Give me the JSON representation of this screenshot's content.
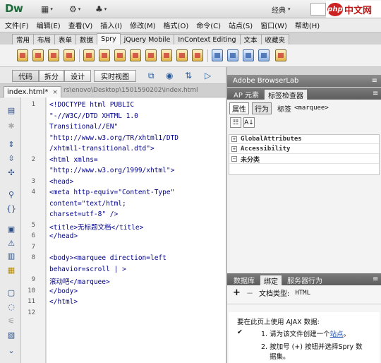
{
  "app": {
    "logo": "Dw",
    "layout_label": "经典",
    "watermark_text": "中文网",
    "watermark_badge": "php"
  },
  "menu": [
    "文件(F)",
    "编辑(E)",
    "查看(V)",
    "插入(I)",
    "修改(M)",
    "格式(O)",
    "命令(C)",
    "站点(S)",
    "窗口(W)",
    "帮助(H)"
  ],
  "insert_tabs": [
    {
      "label": "常用",
      "active": false
    },
    {
      "label": "布局",
      "active": false
    },
    {
      "label": "表单",
      "active": false
    },
    {
      "label": "数据",
      "active": false
    },
    {
      "label": "Spry",
      "active": true
    },
    {
      "label": "jQuery Mobile",
      "active": false
    },
    {
      "label": "InContext Editing",
      "active": false
    },
    {
      "label": "文本",
      "active": false
    },
    {
      "label": "收藏夹",
      "active": false
    }
  ],
  "view_buttons": [
    "代码",
    "拆分",
    "设计",
    "实时视图"
  ],
  "doc_tab": {
    "label": "index.html*",
    "close": "×",
    "path": "rs\\enovo\\Desktop\\1501590202\\index.html"
  },
  "code_lines": [
    {
      "num": "1",
      "text": "<!DOCTYPE html PUBLIC"
    },
    {
      "num": "",
      "text": "\"-//W3C//DTD XHTML 1.0"
    },
    {
      "num": "",
      "text": "Transitional//EN\""
    },
    {
      "num": "",
      "text": "\"http://www.w3.org/TR/xhtml1/DTD"
    },
    {
      "num": "",
      "text": "/xhtml1-transitional.dtd\">"
    },
    {
      "num": "2",
      "text": "<html xmlns="
    },
    {
      "num": "",
      "text": "\"http://www.w3.org/1999/xhtml\">"
    },
    {
      "num": "3",
      "text": "<head>"
    },
    {
      "num": "4",
      "text": "<meta http-equiv=\"Content-Type\""
    },
    {
      "num": "",
      "text": "content=\"text/html;"
    },
    {
      "num": "",
      "text": "charset=utf-8\" />"
    },
    {
      "num": "5",
      "text": "<title>无标题文档</title>"
    },
    {
      "num": "6",
      "text": "</head>"
    },
    {
      "num": "7",
      "text": ""
    },
    {
      "num": "8",
      "text": "<body><marquee direction=left"
    },
    {
      "num": "",
      "text": "behavior=scroll | >"
    },
    {
      "num": "9",
      "text": "滚动吧</marquee>"
    },
    {
      "num": "10",
      "text": "</body>"
    },
    {
      "num": "11",
      "text": "</html>"
    },
    {
      "num": "12",
      "text": ""
    }
  ],
  "browserlab": {
    "title": "Adobe BrowserLab",
    "menu": "≡"
  },
  "ap_tabs": [
    {
      "label": "AP 元素",
      "active": false
    },
    {
      "label": "标签检查器",
      "active": true
    }
  ],
  "tag_inspector": {
    "attr_btn": "属性",
    "behavior_btn": "行为",
    "tag_label": "标签",
    "tag_value": "<marquee>",
    "categories": [
      "GlobalAttributes",
      "Accessibility",
      "未分类"
    ]
  },
  "bottom_tabs": [
    {
      "label": "数据库",
      "active": false
    },
    {
      "label": "绑定",
      "active": true
    },
    {
      "label": "服务器行为",
      "active": false
    }
  ],
  "bindings": {
    "add": "+",
    "remove": "−",
    "doc_type_label": "文档类型:",
    "doc_type_value": "HTML",
    "intro": "要在此页上使用 AJAX 数据:",
    "check": "✔",
    "step1_prefix": "1. 请为该文件创建一个",
    "step1_link": "站点",
    "step1_suffix": "。",
    "step2_line1": "2. 按加号 (+) 按钮并选择Spry 数",
    "step2_line2": "据集。"
  },
  "colors": {
    "code_tag": "#00008b",
    "link": "#1a4fb0",
    "watermark_red": "#c01818"
  }
}
